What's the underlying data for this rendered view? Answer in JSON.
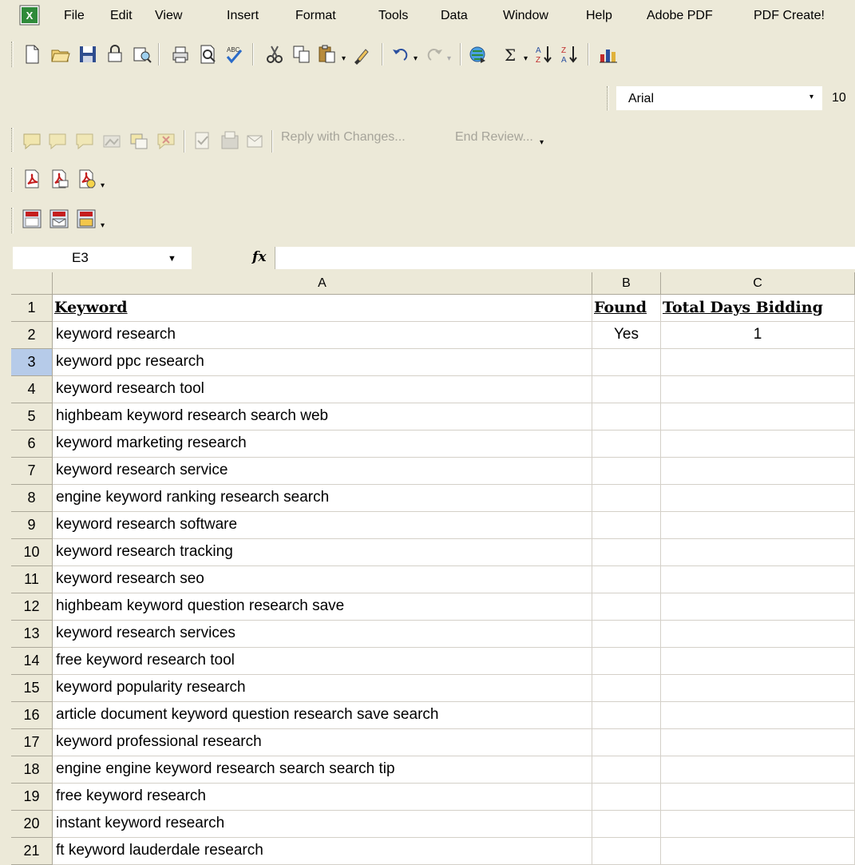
{
  "menu": {
    "items": [
      "File",
      "Edit",
      "View",
      "Insert",
      "Format",
      "Tools",
      "Data",
      "Window",
      "Help",
      "Adobe PDF",
      "PDF Create!"
    ]
  },
  "standard_toolbar": {
    "icons": [
      "new-icon",
      "open-icon",
      "save-icon",
      "permission-icon",
      "research-icon",
      "print-icon",
      "print-preview-icon",
      "spelling-icon",
      "cut-icon",
      "copy-icon",
      "paste-icon",
      "format-painter-icon",
      "undo-icon",
      "redo-icon",
      "hyperlink-icon",
      "autosum-icon",
      "sort-ascending-icon",
      "sort-descending-icon",
      "chart-wizard-icon"
    ]
  },
  "formatting": {
    "font_name": "Arial",
    "font_size": "10"
  },
  "reviewing_toolbar": {
    "reply_label": "Reply with Changes...",
    "end_review_label": "End Review..."
  },
  "formula_bar": {
    "name_box": "E3",
    "fx_label": "fx",
    "formula": ""
  },
  "sheet": {
    "column_headers": [
      "A",
      "B",
      "C"
    ],
    "active_row": 3,
    "rows": [
      {
        "n": "1",
        "a": "Keyword",
        "b": "Found",
        "c": "Total Days Bidding"
      },
      {
        "n": "2",
        "a": "keyword research",
        "b": "Yes",
        "c": "1"
      },
      {
        "n": "3",
        "a": "keyword ppc research",
        "b": "",
        "c": ""
      },
      {
        "n": "4",
        "a": "keyword research tool",
        "b": "",
        "c": ""
      },
      {
        "n": "5",
        "a": "highbeam keyword research search web",
        "b": "",
        "c": ""
      },
      {
        "n": "6",
        "a": "keyword marketing research",
        "b": "",
        "c": ""
      },
      {
        "n": "7",
        "a": "keyword research service",
        "b": "",
        "c": ""
      },
      {
        "n": "8",
        "a": "engine keyword ranking research search",
        "b": "",
        "c": ""
      },
      {
        "n": "9",
        "a": "keyword research software",
        "b": "",
        "c": ""
      },
      {
        "n": "10",
        "a": "keyword research tracking",
        "b": "",
        "c": ""
      },
      {
        "n": "11",
        "a": "keyword research seo",
        "b": "",
        "c": ""
      },
      {
        "n": "12",
        "a": "highbeam keyword question research save",
        "b": "",
        "c": ""
      },
      {
        "n": "13",
        "a": "keyword research services",
        "b": "",
        "c": ""
      },
      {
        "n": "14",
        "a": "free keyword research tool",
        "b": "",
        "c": ""
      },
      {
        "n": "15",
        "a": "keyword popularity research",
        "b": "",
        "c": ""
      },
      {
        "n": "16",
        "a": "article document keyword question research save search",
        "b": "",
        "c": ""
      },
      {
        "n": "17",
        "a": "keyword professional research",
        "b": "",
        "c": ""
      },
      {
        "n": "18",
        "a": "engine engine keyword research search search tip",
        "b": "",
        "c": ""
      },
      {
        "n": "19",
        "a": "free keyword research",
        "b": "",
        "c": ""
      },
      {
        "n": "20",
        "a": "instant keyword research",
        "b": "",
        "c": ""
      },
      {
        "n": "21",
        "a": "ft keyword lauderdale research",
        "b": "",
        "c": ""
      }
    ]
  }
}
